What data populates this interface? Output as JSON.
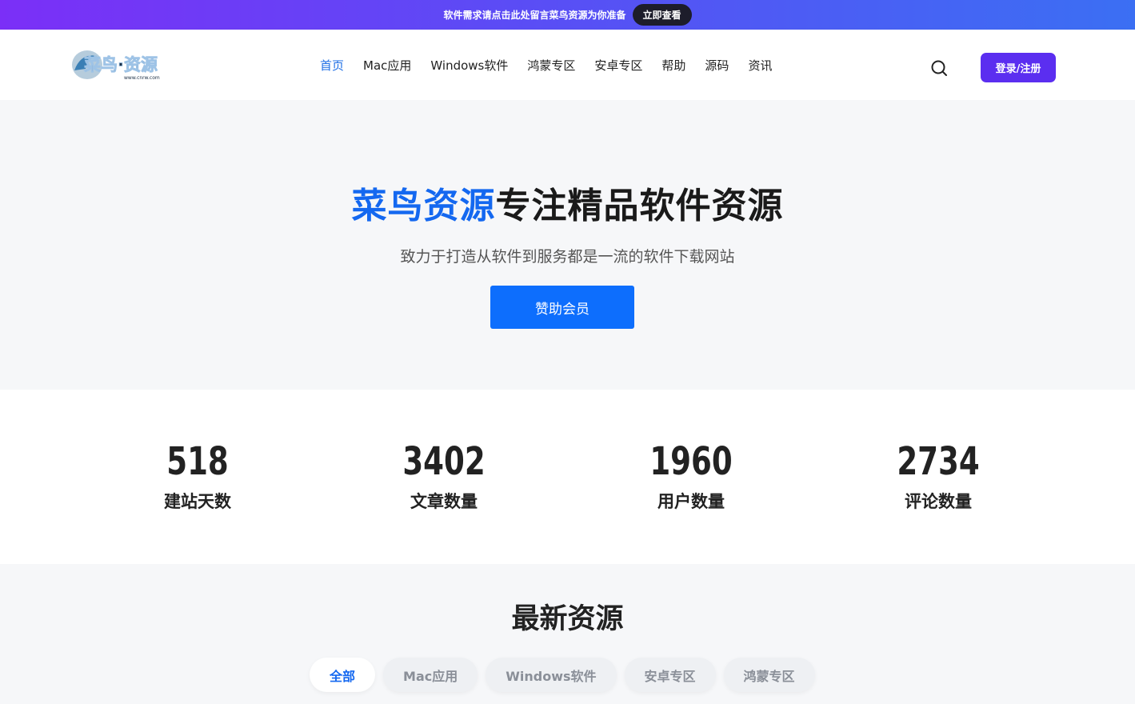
{
  "announcement": {
    "text": "软件需求请点击此处留言菜鸟资源为你准备",
    "button": "立即查看"
  },
  "header": {
    "logo_text": "菜鸟·资源",
    "logo_sub": "www.cnrw.com",
    "nav": [
      "首页",
      "Mac应用",
      "Windows软件",
      "鸿蒙专区",
      "安卓专区",
      "帮助",
      "源码",
      "资讯"
    ],
    "active_nav": "首页",
    "login_label": "登录/注册",
    "brand_color": "#5b2ef0"
  },
  "hero": {
    "title_brand": "菜鸟资源",
    "title_rest": "专注精品软件资源",
    "subtitle": "致力于打造从软件到服务都是一流的软件下载网站",
    "button": "赞助会员"
  },
  "stats": [
    {
      "value": "518",
      "label": "建站天数"
    },
    {
      "value": "3402",
      "label": "文章数量"
    },
    {
      "value": "1960",
      "label": "用户数量"
    },
    {
      "value": "2734",
      "label": "评论数量"
    }
  ],
  "latest": {
    "title": "最新资源",
    "tabs": [
      "全部",
      "Mac应用",
      "Windows软件",
      "安卓专区",
      "鸿蒙专区"
    ],
    "active_tab": "全部"
  }
}
